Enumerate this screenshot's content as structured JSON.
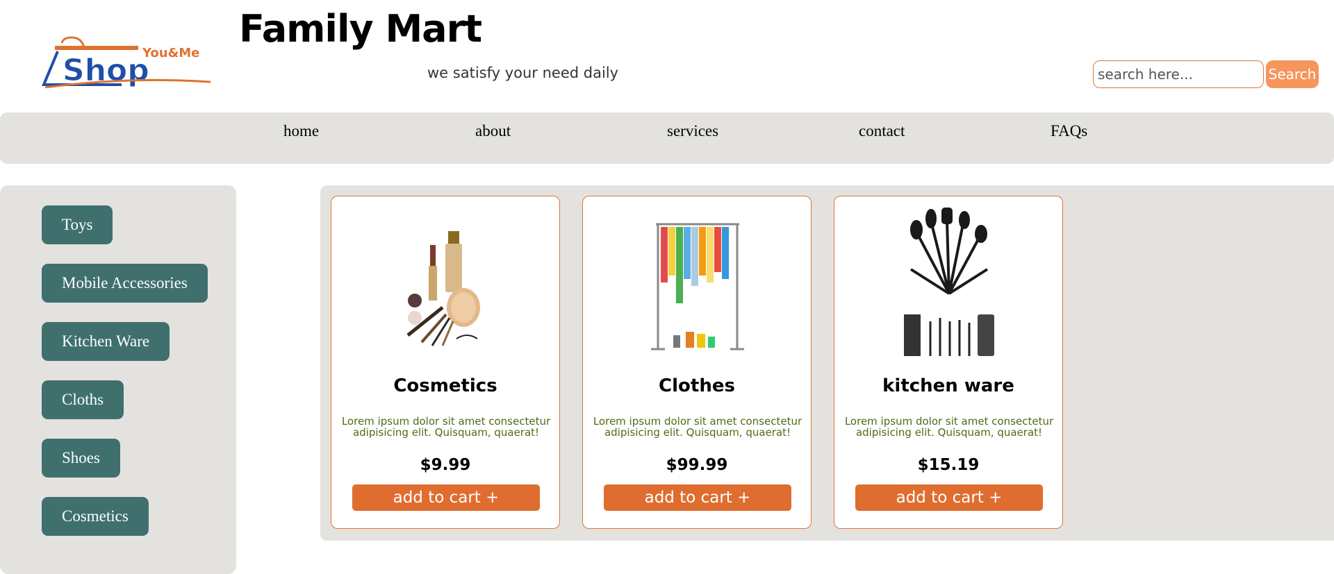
{
  "header": {
    "logo": {
      "top_text": "You&Me",
      "main_text": "Shop"
    },
    "title": "Family Mart",
    "tagline": "we satisfy your need daily",
    "search": {
      "placeholder": "search here...",
      "button_label": "Search"
    }
  },
  "nav": {
    "items": [
      {
        "label": "home"
      },
      {
        "label": "about"
      },
      {
        "label": "services"
      },
      {
        "label": "contact"
      },
      {
        "label": "FAQs"
      }
    ]
  },
  "sidebar": {
    "categories": [
      {
        "label": "Toys"
      },
      {
        "label": "Mobile Accessories"
      },
      {
        "label": "Kitchen Ware"
      },
      {
        "label": "Cloths"
      },
      {
        "label": "Shoes"
      },
      {
        "label": "Cosmetics"
      }
    ]
  },
  "products": [
    {
      "title": "Cosmetics",
      "description": "Lorem ipsum dolor sit amet consectetur adipisicing elit. Quisquam, quaerat!",
      "price": "$9.99",
      "button_label": "add to cart +",
      "image": "cosmetics-image"
    },
    {
      "title": "Clothes",
      "description": "Lorem ipsum dolor sit amet consectetur adipisicing elit. Quisquam, quaerat!",
      "price": "$99.99",
      "button_label": "add to cart +",
      "image": "clothes-rack-image"
    },
    {
      "title": "kitchen ware",
      "description": "Lorem ipsum dolor sit amet consectetur adipisicing elit. Quisquam, quaerat!",
      "price": "$15.19",
      "button_label": "add to cart +",
      "image": "kitchen-utensils-image"
    }
  ],
  "colors": {
    "accent_orange": "#df6d2f",
    "search_button": "#f6955c",
    "category_button": "#3f706e",
    "panel_gray": "#e4e2df",
    "logo_blue": "#1f4fa8"
  }
}
